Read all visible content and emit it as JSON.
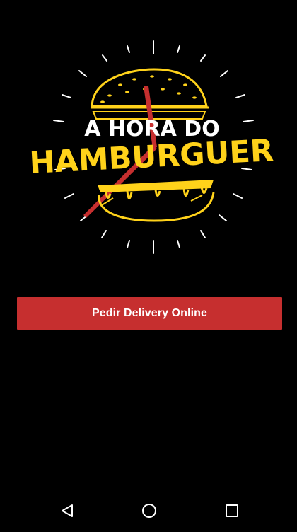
{
  "logo": {
    "line1": "A HORA DO",
    "line2": "HAMBURGUER",
    "colors": {
      "accent": "#ffd21a",
      "hand": "#c62f2f",
      "text": "#ffffff"
    }
  },
  "cta": {
    "label": "Pedir Delivery Online",
    "background": "#c62f2f"
  },
  "navbar": {
    "back_icon": "triangle-back-icon",
    "home_icon": "circle-home-icon",
    "recent_icon": "square-recents-icon"
  }
}
